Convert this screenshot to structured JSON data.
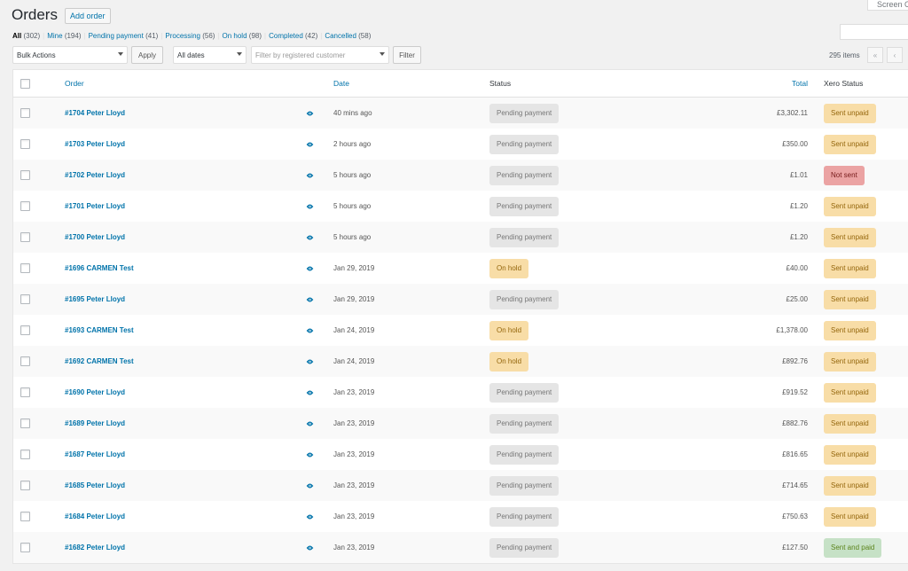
{
  "screen_options": {
    "label": "Screen Options"
  },
  "header": {
    "title": "Orders",
    "add_order_label": "Add order"
  },
  "status_filters": [
    {
      "label": "All",
      "count": "(302)",
      "current": true
    },
    {
      "label": "Mine",
      "count": "(194)"
    },
    {
      "label": "Pending payment",
      "count": "(41)"
    },
    {
      "label": "Processing",
      "count": "(56)"
    },
    {
      "label": "On hold",
      "count": "(98)"
    },
    {
      "label": "Completed",
      "count": "(42)"
    },
    {
      "label": "Cancelled",
      "count": "(58)"
    }
  ],
  "tablenav": {
    "bulk_actions": "Bulk Actions",
    "apply_label": "Apply",
    "date_filter": "All dates",
    "customer_placeholder": "Filter by registered customer",
    "filter_label": "Filter",
    "items_count": "295 items",
    "first_page": "«",
    "prev_page": "‹"
  },
  "columns": {
    "order": "Order",
    "date": "Date",
    "status": "Status",
    "total": "Total",
    "xero": "Xero Status"
  },
  "status_colors": {
    "pending": {
      "bg": "#e5e5e5",
      "fg": "#777777"
    },
    "on-hold": {
      "bg": "#f8dda7",
      "fg": "#94660c"
    },
    "sent-unpaid": {
      "bg": "#f8dda7",
      "fg": "#94660c"
    },
    "not-sent": {
      "bg": "#eba3a3",
      "fg": "#761919"
    },
    "sent-paid": {
      "bg": "#c6e1c6",
      "fg": "#5b841b"
    }
  },
  "orders": [
    {
      "order": "#1704 Peter Lloyd",
      "date": "40 mins ago",
      "status": "Pending payment",
      "status_type": "pending",
      "total": "£3,302.11",
      "xero": "Sent unpaid",
      "xero_type": "sent-unpaid"
    },
    {
      "order": "#1703 Peter Lloyd",
      "date": "2 hours ago",
      "status": "Pending payment",
      "status_type": "pending",
      "total": "£350.00",
      "xero": "Sent unpaid",
      "xero_type": "sent-unpaid"
    },
    {
      "order": "#1702 Peter Lloyd",
      "date": "5 hours ago",
      "status": "Pending payment",
      "status_type": "pending",
      "total": "£1.01",
      "xero": "Not sent",
      "xero_type": "not-sent"
    },
    {
      "order": "#1701 Peter Lloyd",
      "date": "5 hours ago",
      "status": "Pending payment",
      "status_type": "pending",
      "total": "£1.20",
      "xero": "Sent unpaid",
      "xero_type": "sent-unpaid"
    },
    {
      "order": "#1700 Peter Lloyd",
      "date": "5 hours ago",
      "status": "Pending payment",
      "status_type": "pending",
      "total": "£1.20",
      "xero": "Sent unpaid",
      "xero_type": "sent-unpaid"
    },
    {
      "order": "#1696 CARMEN Test",
      "date": "Jan 29, 2019",
      "status": "On hold",
      "status_type": "on-hold",
      "total": "£40.00",
      "xero": "Sent unpaid",
      "xero_type": "sent-unpaid"
    },
    {
      "order": "#1695 Peter Lloyd",
      "date": "Jan 29, 2019",
      "status": "Pending payment",
      "status_type": "pending",
      "total": "£25.00",
      "xero": "Sent unpaid",
      "xero_type": "sent-unpaid"
    },
    {
      "order": "#1693 CARMEN Test",
      "date": "Jan 24, 2019",
      "status": "On hold",
      "status_type": "on-hold",
      "total": "£1,378.00",
      "xero": "Sent unpaid",
      "xero_type": "sent-unpaid"
    },
    {
      "order": "#1692 CARMEN Test",
      "date": "Jan 24, 2019",
      "status": "On hold",
      "status_type": "on-hold",
      "total": "£892.76",
      "xero": "Sent unpaid",
      "xero_type": "sent-unpaid"
    },
    {
      "order": "#1690 Peter Lloyd",
      "date": "Jan 23, 2019",
      "status": "Pending payment",
      "status_type": "pending",
      "total": "£919.52",
      "xero": "Sent unpaid",
      "xero_type": "sent-unpaid"
    },
    {
      "order": "#1689 Peter Lloyd",
      "date": "Jan 23, 2019",
      "status": "Pending payment",
      "status_type": "pending",
      "total": "£882.76",
      "xero": "Sent unpaid",
      "xero_type": "sent-unpaid"
    },
    {
      "order": "#1687 Peter Lloyd",
      "date": "Jan 23, 2019",
      "status": "Pending payment",
      "status_type": "pending",
      "total": "£816.65",
      "xero": "Sent unpaid",
      "xero_type": "sent-unpaid"
    },
    {
      "order": "#1685 Peter Lloyd",
      "date": "Jan 23, 2019",
      "status": "Pending payment",
      "status_type": "pending",
      "total": "£714.65",
      "xero": "Sent unpaid",
      "xero_type": "sent-unpaid"
    },
    {
      "order": "#1684 Peter Lloyd",
      "date": "Jan 23, 2019",
      "status": "Pending payment",
      "status_type": "pending",
      "total": "£750.63",
      "xero": "Sent unpaid",
      "xero_type": "sent-unpaid"
    },
    {
      "order": "#1682 Peter Lloyd",
      "date": "Jan 23, 2019",
      "status": "Pending payment",
      "status_type": "pending",
      "total": "£127.50",
      "xero": "Sent and paid",
      "xero_type": "sent-paid"
    }
  ]
}
